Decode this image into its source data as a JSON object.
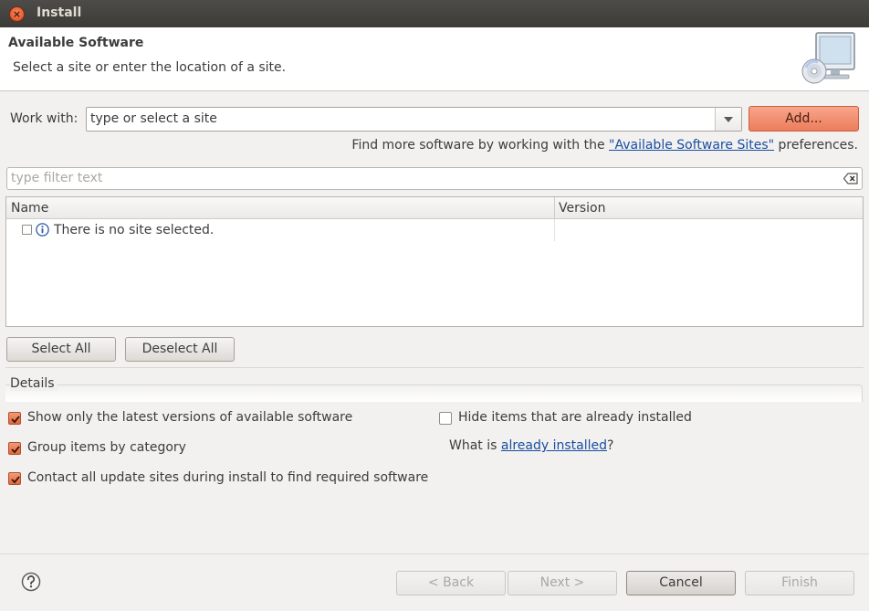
{
  "window": {
    "title": "Install"
  },
  "banner": {
    "title": "Available Software",
    "description": "Select a site or enter the location of a site."
  },
  "work_with": {
    "label": "Work with:",
    "value": "type or select a site",
    "add_label": "Add..."
  },
  "hint": {
    "prefix": "Find more software by working with the ",
    "link": "\"Available Software Sites\"",
    "suffix": " preferences."
  },
  "filter": {
    "placeholder": "type filter text"
  },
  "table": {
    "columns": [
      "Name",
      "Version"
    ],
    "rows": [
      {
        "name": "There is no site selected.",
        "version": ""
      }
    ]
  },
  "selection": {
    "select_all": "Select All",
    "deselect_all": "Deselect All"
  },
  "details": {
    "label": "Details"
  },
  "options": {
    "latest_only": {
      "label": "Show only the latest versions of available software",
      "checked": true
    },
    "group_by_category": {
      "label": "Group items by category",
      "checked": true
    },
    "contact_sites": {
      "label": "Contact all update sites during install to find required software",
      "checked": true
    },
    "hide_installed": {
      "label": "Hide items that are already installed",
      "checked": false
    },
    "what_is_prefix": "What is ",
    "what_is_link": "already installed",
    "what_is_suffix": "?"
  },
  "footer": {
    "back": "< Back",
    "next": "Next >",
    "cancel": "Cancel",
    "finish": "Finish"
  },
  "colors": {
    "accent": "#ec7d5c",
    "link": "#1a4fa0",
    "titlebar": "#3c3b37"
  },
  "icons": {
    "close": "close-icon",
    "banner": "computer-install-icon",
    "dropdown": "chevron-down-icon",
    "clear": "clear-icon",
    "info": "info-icon",
    "help": "help-icon"
  }
}
